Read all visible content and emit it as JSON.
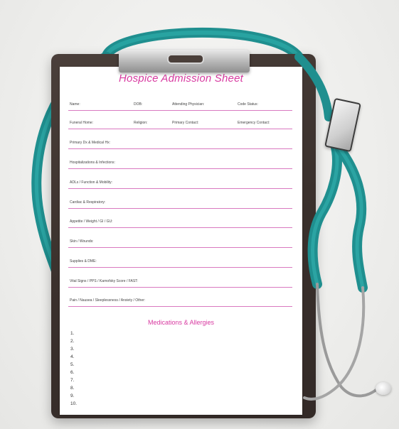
{
  "sheet": {
    "title": "Hospice Admission Sheet",
    "header_row_1": [
      "Name:",
      "DOB:",
      "Attending Physician:",
      "Code Status:"
    ],
    "header_row_2": [
      "Funeral Home:",
      "Religion:",
      "Primary Contact:",
      "Emergency Contact:"
    ],
    "sections": [
      "Primary Dx & Medical Hx:",
      "Hospitalizations & Infections:",
      "ADLs / Function & Mobility:",
      "Cardiac & Respiratory:",
      "Appetite / Weight / GI / GU:",
      "Skin / Wounds:",
      "Supplies & DME:",
      "Vital Signs / PPS / Karnofsky Score / FAST:",
      "Pain / Nausea / Sleeplessness / Anxiety / Other:"
    ],
    "medications_title": "Medications & Allergies",
    "medication_numbers": [
      "1.",
      "2.",
      "3.",
      "4.",
      "5.",
      "6.",
      "7.",
      "8.",
      "9.",
      "10."
    ]
  },
  "colors": {
    "accent_pink": "#d83aa1",
    "clipboard": "#3b312d",
    "stethoscope_teal": "#1f9a9a",
    "background": "#eeeeec"
  }
}
